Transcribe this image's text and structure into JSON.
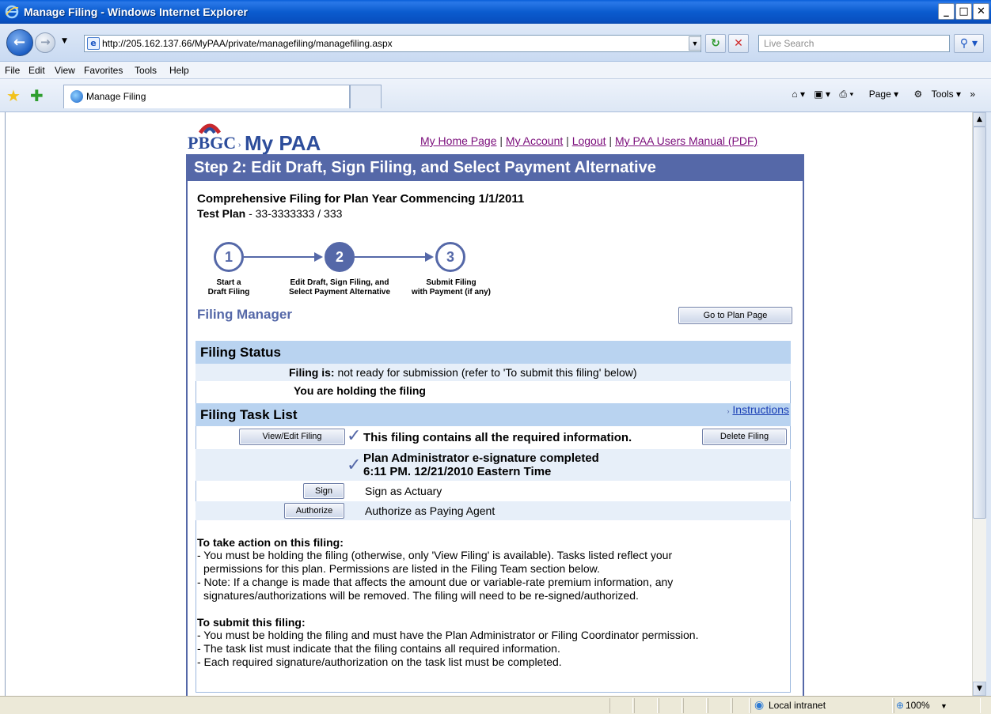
{
  "window": {
    "title": "Manage Filing - Windows Internet Explorer",
    "minimize": "_",
    "maximize": "□",
    "close": "✕"
  },
  "nav": {
    "url": "http://205.162.137.66/MyPAA/private/managefiling/managefiling.aspx",
    "search_placeholder": "Live Search"
  },
  "menu": [
    "File",
    "Edit",
    "View",
    "Favorites",
    "Tools",
    "Help"
  ],
  "tabs": {
    "active_tab": "Manage Filing"
  },
  "command_bar": {
    "page_label": "Page",
    "tools_label": "Tools"
  },
  "page": {
    "logo": {
      "agency": "PBGC",
      "product": "My PAA"
    },
    "top_links": [
      "My Home Page",
      "My Account",
      "Logout",
      "My PAA Users Manual (PDF)"
    ],
    "link_separator": "|",
    "step_banner": "Step 2: Edit Draft, Sign Filing, and Select Payment Alternative",
    "filing_title": "Comprehensive Filing for Plan Year Commencing 1/1/2011",
    "plan_name": "Test Plan",
    "plan_id": " - 33-3333333 / 333",
    "steps": [
      {
        "number": "1",
        "label_line1": "Start a",
        "label_line2": "Draft Filing"
      },
      {
        "number": "2",
        "label_line1": "Edit Draft, Sign Filing, and",
        "label_line2": "Select Payment Alternative"
      },
      {
        "number": "3",
        "label_line1": "Submit Filing",
        "label_line2": "with Payment (if any)"
      }
    ],
    "filing_manager_heading": "Filing Manager",
    "go_to_plan_button": "Go to Plan Page",
    "filing_status": {
      "heading": "Filing Status",
      "status_label": "Filing is:",
      "status_value": " not ready for submission (refer to 'To submit this filing' below)",
      "holding": "You are holding the filing"
    },
    "task_list": {
      "heading": "Filing Task List",
      "instructions_link": "Instructions",
      "view_edit_button": "View/Edit Filing",
      "delete_button": "Delete Filing",
      "required_info": "This filing contains all the required information.",
      "esig_line1": "Plan Administrator e-signature completed",
      "esig_line2": "6:11 PM. 12/21/2010 Eastern Time",
      "sign_button": "Sign",
      "sign_label": "Sign as Actuary",
      "authorize_button": "Authorize",
      "authorize_label": "Authorize as Paying Agent"
    },
    "action_notes": {
      "heading": "To take action on this filing:",
      "line1": "- You must be holding the filing (otherwise, only 'View Filing' is available). Tasks listed reflect your",
      "line2": "  permissions for this plan. Permissions are listed in the Filing Team section below.",
      "line3": "- Note: If a change is made that affects the amount due or variable-rate premium information, any",
      "line4": "  signatures/authorizations will be removed. The filing will need to be re-signed/authorized."
    },
    "submit_notes": {
      "heading": "To submit this filing:",
      "line1": "- You must be holding the filing and must have the Plan Administrator or Filing Coordinator permission.",
      "line2": "- The task list must indicate that the filing contains all required information.",
      "line3": "- Each required signature/authorization on the task list must be completed."
    }
  },
  "status_bar": {
    "zone": "Local intranet",
    "zoom": "100%"
  }
}
